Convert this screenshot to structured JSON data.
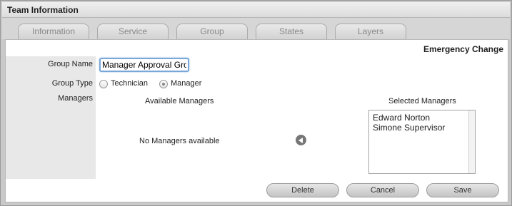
{
  "window": {
    "title": "Team Information"
  },
  "tabs": [
    {
      "label": "Information"
    },
    {
      "label": "Service"
    },
    {
      "label": "Group"
    },
    {
      "label": "States"
    },
    {
      "label": "Layers"
    }
  ],
  "form": {
    "section_heading": "Emergency Change",
    "group_name_label": "Group Name",
    "group_name_value": "Manager Approval Gro",
    "group_type_label": "Group Type",
    "group_type_options": [
      {
        "label": "Technician",
        "checked": false
      },
      {
        "label": "Manager",
        "checked": true
      }
    ],
    "managers_label": "Managers",
    "available_heading": "Available Managers",
    "available_empty_message": "No Managers available",
    "selected_heading": "Selected Managers",
    "selected_managers": [
      "Edward Norton",
      "Simone Supervisor"
    ]
  },
  "actions": {
    "delete_label": "Delete",
    "cancel_label": "Cancel",
    "save_label": "Save"
  },
  "icons": {
    "move_left": "arrow-left-icon"
  }
}
